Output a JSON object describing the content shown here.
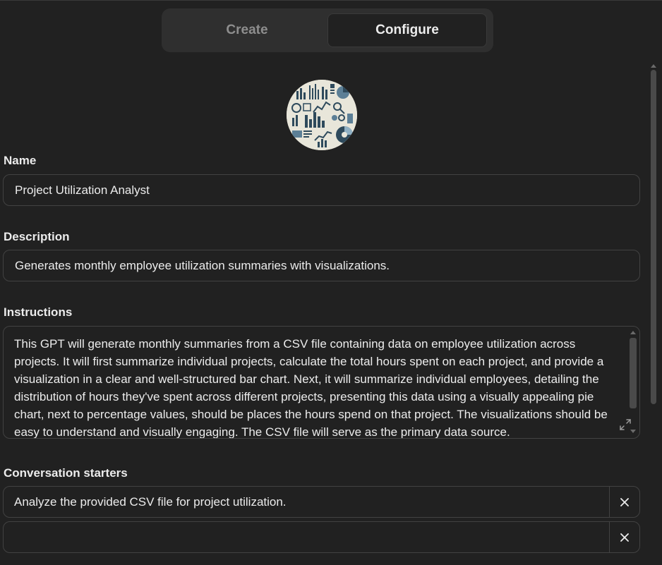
{
  "tabs": {
    "create_label": "Create",
    "configure_label": "Configure",
    "active": "configure"
  },
  "avatar": {
    "icon": "data-analytics-collage-icon"
  },
  "form": {
    "name": {
      "label": "Name",
      "value": "Project Utilization Analyst"
    },
    "description": {
      "label": "Description",
      "value": "Generates monthly employee utilization summaries with visualizations."
    },
    "instructions": {
      "label": "Instructions",
      "value": "This GPT will generate monthly summaries from a CSV file containing data on employee utilization across projects. It will first summarize individual projects, calculate the total hours spent on each project, and provide a visualization in a clear and well-structured bar chart. Next, it will summarize individual employees, detailing the distribution of hours they've spent across different projects, presenting this data using a visually appealing pie chart, next to percentage values, should be places the hours spend on that project. The visualizations should be easy to understand and visually engaging. The CSV file will serve as the primary data source."
    },
    "conversation_starters": {
      "label": "Conversation starters",
      "items": [
        "Analyze the provided CSV file for project utilization.",
        ""
      ]
    }
  },
  "colors": {
    "background": "#212121",
    "panel": "#2f2f2f",
    "border": "#424242",
    "text": "#ececec",
    "muted": "#8e8e8e"
  }
}
